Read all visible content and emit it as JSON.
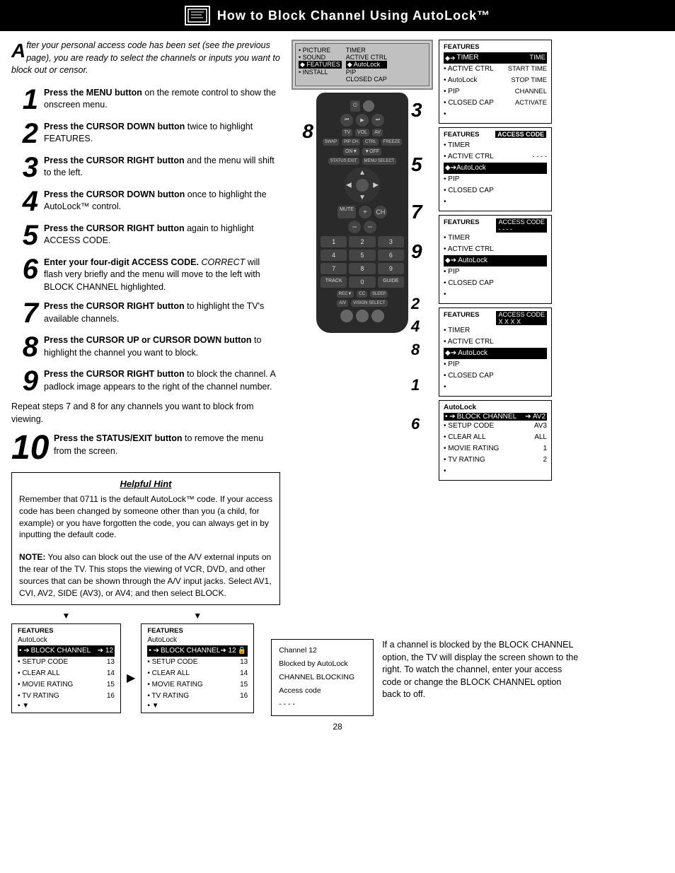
{
  "header": {
    "title": "How to Block Channel Using AutoLock™"
  },
  "intro": {
    "text": "fter your personal access code has been set (see the previous page), you are ready to select the channels or inputs you want to block out or censor."
  },
  "steps": [
    {
      "number": "1",
      "size": "normal",
      "bold_part": "Press the MENU button",
      "rest": " on the remote control to show the onscreen menu."
    },
    {
      "number": "2",
      "size": "normal",
      "bold_part": "Press the CURSOR DOWN button",
      "rest": " twice to highlight FEATURES."
    },
    {
      "number": "3",
      "size": "normal",
      "bold_part": "Press the CURSOR RIGHT button",
      "rest": " and the menu will shift to the left."
    },
    {
      "number": "4",
      "size": "normal",
      "bold_part": "Press the CURSOR DOWN button",
      "rest": " once to highlight the AutoLock™ control."
    },
    {
      "number": "5",
      "size": "normal",
      "bold_part": "Press the CURSOR RIGHT button",
      "rest": " again to highlight ACCESS CODE."
    },
    {
      "number": "6",
      "size": "normal",
      "bold_part": "Enter your four-digit ACCESS CODE.",
      "italic_part": " CORRECT",
      "rest": " will flash very briefly and the menu will move to the left with BLOCK CHANNEL highlighted."
    },
    {
      "number": "7",
      "size": "normal",
      "bold_part": "Press the CURSOR RIGHT button",
      "rest": " to highlight the TV's available channels."
    },
    {
      "number": "8",
      "size": "normal",
      "bold_part": "Press the CURSOR UP or CURSOR DOWN button",
      "rest": " to highlight the channel you want to block."
    },
    {
      "number": "9",
      "size": "normal",
      "bold_part": "Press the CURSOR RIGHT button",
      "rest": " to block the channel. A padlock image appears to the right of the channel number."
    }
  ],
  "repeat_note": "Repeat steps 7 and 8 for any channels you want to block from viewing.",
  "step10": {
    "number": "10",
    "bold_part": "Press the STATUS/EXIT button",
    "rest": " to remove the menu from the screen."
  },
  "hint": {
    "title": "Helpful Hint",
    "paragraphs": [
      "Remember that 0711 is the default AutoLock™ code. If your access code has been changed by someone other than you (a child, for example) or you have forgotten the code, you can always get in by inputting the default code.",
      "NOTE:  You also can block out the use of the A/V external inputs on the rear of the TV. This stops the viewing of VCR, DVD, and other sources that can be shown through the A/V input jacks. Select AV1, CVI, AV2, SIDE (AV3), or AV4; and then select BLOCK."
    ]
  },
  "screen_panels": {
    "panel1": {
      "title": "FEATURES",
      "items": [
        {
          "bullet": "◆",
          "arrow": "➔",
          "label": "TIMER",
          "right": "TIME"
        },
        {
          "bullet": "•",
          "label": "ACTIVE CTRL",
          "right": "START TIME"
        },
        {
          "bullet": "•",
          "label": "AutoLock",
          "right": "STOP TIME"
        },
        {
          "bullet": "•",
          "label": "PIP",
          "right": "CHANNEL"
        },
        {
          "bullet": "•",
          "label": "CLOSED CAP",
          "right": "ACTIVATE"
        },
        {
          "bullet": "•",
          "label": ""
        }
      ],
      "highlighted_index": 0
    },
    "panel2": {
      "title": "FEATURES",
      "items": [
        {
          "bullet": "•",
          "label": "TIMER",
          "right": "ACCESS CODE"
        },
        {
          "bullet": "•",
          "label": "ACTIVE CTRL",
          "right": "- - - -"
        },
        {
          "bullet": "◆",
          "arrow": "➔",
          "label": "AutoLock"
        },
        {
          "bullet": "•",
          "label": "PIP"
        },
        {
          "bullet": "•",
          "label": "CLOSED CAP"
        },
        {
          "bullet": "•",
          "label": ""
        }
      ],
      "highlighted_index": 2
    },
    "panel3": {
      "title": "FEATURES",
      "label": "ACCESS CODE",
      "items": [
        {
          "bullet": "•",
          "label": "TIMER"
        },
        {
          "bullet": "•",
          "label": "ACTIVE CTRL"
        },
        {
          "bullet": "◆",
          "arrow": "➔",
          "label": "AutoLock"
        },
        {
          "bullet": "•",
          "label": "PIP"
        },
        {
          "bullet": "•",
          "label": "CLOSED CAP"
        },
        {
          "bullet": "•",
          "label": ""
        }
      ],
      "access_code": "- - - -",
      "highlighted_index": 2
    },
    "panel4": {
      "title": "FEATURES",
      "label": "ACCESS CODE",
      "items": [
        {
          "bullet": "•",
          "label": "TIMER"
        },
        {
          "bullet": "•",
          "label": "ACTIVE CTRL"
        },
        {
          "bullet": "◆",
          "arrow": "➔",
          "label": "AutoLock"
        },
        {
          "bullet": "•",
          "label": "PIP"
        },
        {
          "bullet": "•",
          "label": "CLOSED CAP"
        },
        {
          "bullet": "•",
          "label": ""
        }
      ],
      "access_code": "X X X X",
      "highlighted_index": 2
    },
    "autolock_panel": {
      "title": "AutoLock",
      "items": [
        {
          "bullet": "•",
          "arrow": "➔",
          "label": "BLOCK CHANNEL",
          "right": "AV2",
          "highlighted": true
        },
        {
          "bullet": "•",
          "label": "SETUP CODE",
          "right": "AV3"
        },
        {
          "bullet": "•",
          "label": "CLEAR ALL",
          "right": "ALL"
        },
        {
          "bullet": "•",
          "label": "MOVIE RATING",
          "right": "1"
        },
        {
          "bullet": "•",
          "label": "TV RATING",
          "right": "2"
        },
        {
          "bullet": "•",
          "label": ""
        }
      ]
    }
  },
  "bottom_screens": {
    "panel_left": {
      "title": "FEATURES",
      "subtitle": "AutoLock",
      "items": [
        {
          "bullet": "•",
          "arrow": "➔",
          "label": "BLOCK CHANNEL",
          "right": "12",
          "highlighted": true
        },
        {
          "bullet": "•",
          "label": "SETUP CODE",
          "right": "13"
        },
        {
          "bullet": "•",
          "label": "CLEAR ALL",
          "right": "14"
        },
        {
          "bullet": "•",
          "label": "MOVIE RATING",
          "right": "15"
        },
        {
          "bullet": "•",
          "label": "TV RATING",
          "right": "16"
        },
        {
          "bullet": "•",
          "label": ""
        }
      ]
    },
    "panel_right": {
      "title": "FEATURES",
      "subtitle": "AutoLock",
      "items": [
        {
          "bullet": "•",
          "arrow": "➔",
          "label": "BLOCK CHANNEL",
          "right": "12",
          "lock": true,
          "highlighted": true
        },
        {
          "bullet": "•",
          "label": "SETUP CODE",
          "right": "13"
        },
        {
          "bullet": "•",
          "label": "CLEAR ALL",
          "right": "14"
        },
        {
          "bullet": "•",
          "label": "MOVIE RATING",
          "right": "15"
        },
        {
          "bullet": "•",
          "label": "TV RATING",
          "right": "16"
        },
        {
          "bullet": "•",
          "label": ""
        }
      ]
    }
  },
  "channel_blocked": {
    "lines": [
      "Channel 12",
      "Blocked by AutoLock",
      "CHANNEL BLOCKING",
      "Access code",
      "- - - -"
    ]
  },
  "bottom_right_text": "If a channel is blocked by the BLOCK CHANNEL option, the TV will display the screen shown to the right. To watch the channel, enter your access code or change the BLOCK CHANNEL option back to off.",
  "page_number": "28",
  "tv_main_menu": {
    "col1": [
      "• PICTURE",
      "• SOUND",
      "◆ FEATURES",
      "• INSTALL"
    ],
    "col2_title": "",
    "col2": [
      "TIMER",
      "ACTIVE CTRL",
      "AutoLock",
      "PIP",
      "CLOSED CAP"
    ],
    "col1_highlighted": "◆ FEATURES"
  },
  "remote_step_numbers": {
    "left": [
      "8"
    ],
    "center": [
      "3",
      "5",
      "7",
      "9"
    ],
    "bottom_left": [
      "2",
      "4",
      "8"
    ],
    "bottom_right": [
      "1",
      "6"
    ]
  }
}
